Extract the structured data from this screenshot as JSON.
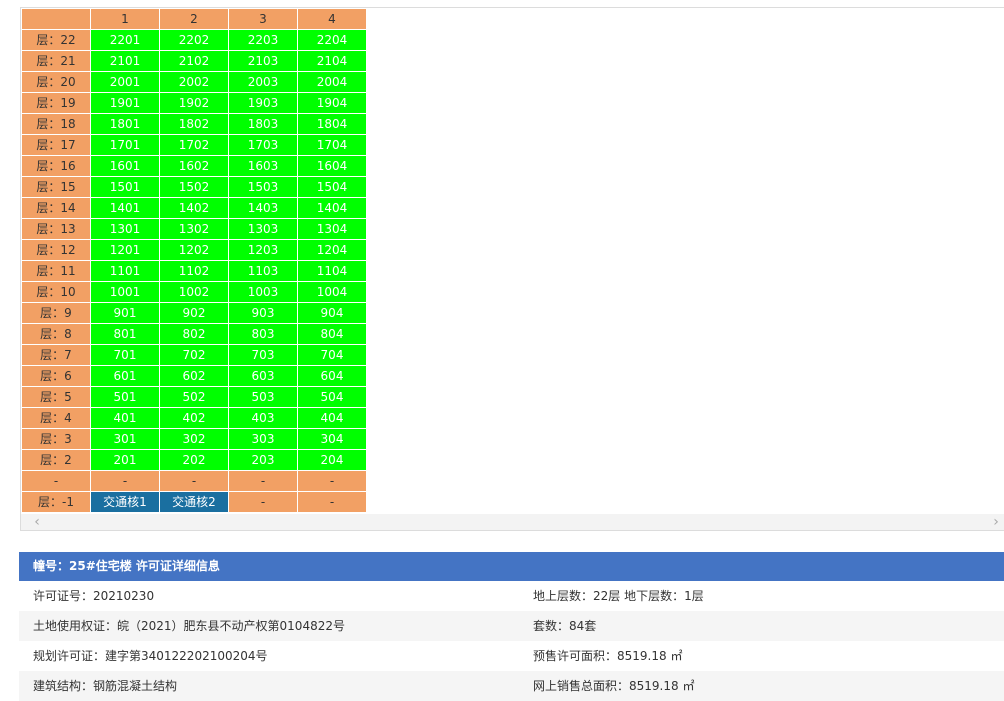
{
  "grid": {
    "columns": [
      "1",
      "2",
      "3",
      "4"
    ],
    "rows": [
      {
        "floor": "层：22",
        "units": [
          "2201",
          "2202",
          "2203",
          "2204"
        ]
      },
      {
        "floor": "层：21",
        "units": [
          "2101",
          "2102",
          "2103",
          "2104"
        ]
      },
      {
        "floor": "层：20",
        "units": [
          "2001",
          "2002",
          "2003",
          "2004"
        ]
      },
      {
        "floor": "层：19",
        "units": [
          "1901",
          "1902",
          "1903",
          "1904"
        ]
      },
      {
        "floor": "层：18",
        "units": [
          "1801",
          "1802",
          "1803",
          "1804"
        ]
      },
      {
        "floor": "层：17",
        "units": [
          "1701",
          "1702",
          "1703",
          "1704"
        ]
      },
      {
        "floor": "层：16",
        "units": [
          "1601",
          "1602",
          "1603",
          "1604"
        ]
      },
      {
        "floor": "层：15",
        "units": [
          "1501",
          "1502",
          "1503",
          "1504"
        ]
      },
      {
        "floor": "层：14",
        "units": [
          "1401",
          "1402",
          "1403",
          "1404"
        ]
      },
      {
        "floor": "层：13",
        "units": [
          "1301",
          "1302",
          "1303",
          "1304"
        ]
      },
      {
        "floor": "层：12",
        "units": [
          "1201",
          "1202",
          "1203",
          "1204"
        ]
      },
      {
        "floor": "层：11",
        "units": [
          "1101",
          "1102",
          "1103",
          "1104"
        ]
      },
      {
        "floor": "层：10",
        "units": [
          "1001",
          "1002",
          "1003",
          "1004"
        ]
      },
      {
        "floor": "层：9",
        "units": [
          "901",
          "902",
          "903",
          "904"
        ]
      },
      {
        "floor": "层：8",
        "units": [
          "801",
          "802",
          "803",
          "804"
        ]
      },
      {
        "floor": "层：7",
        "units": [
          "701",
          "702",
          "703",
          "704"
        ]
      },
      {
        "floor": "层：6",
        "units": [
          "601",
          "602",
          "603",
          "604"
        ]
      },
      {
        "floor": "层：5",
        "units": [
          "501",
          "502",
          "503",
          "504"
        ]
      },
      {
        "floor": "层：4",
        "units": [
          "401",
          "402",
          "403",
          "404"
        ]
      },
      {
        "floor": "层：3",
        "units": [
          "301",
          "302",
          "303",
          "304"
        ]
      },
      {
        "floor": "层：2",
        "units": [
          "201",
          "202",
          "203",
          "204"
        ]
      },
      {
        "floor": "-",
        "units": [
          "-",
          "-",
          "-",
          "-"
        ],
        "style": "orange"
      },
      {
        "floor": "层：-1",
        "units": [
          "交通核1",
          "交通核2",
          "-",
          "-"
        ],
        "style": "basement"
      }
    ],
    "colors": {
      "available": "#00ff00",
      "header": "#f2a064",
      "core": "#1a6fa0"
    },
    "scroll_left_icon": "chevron-left-icon",
    "scroll_right_icon": "chevron-right-icon"
  },
  "info": {
    "header": "幢号：25#住宅楼 许可证详细信息",
    "rows": [
      {
        "left": "许可证号：20210230",
        "right": "地上层数：22层  地下层数：1层"
      },
      {
        "left": "土地使用权证：皖（2021）肥东县不动产权第0104822号",
        "right": "套数：84套"
      },
      {
        "left": "规划许可证：建字第340122202100204号",
        "right": "预售许可面积：8519.18 ㎡"
      },
      {
        "left": "建筑结构：钢筋混凝土结构",
        "right": "网上销售总面积：8519.18 ㎡"
      }
    ]
  }
}
